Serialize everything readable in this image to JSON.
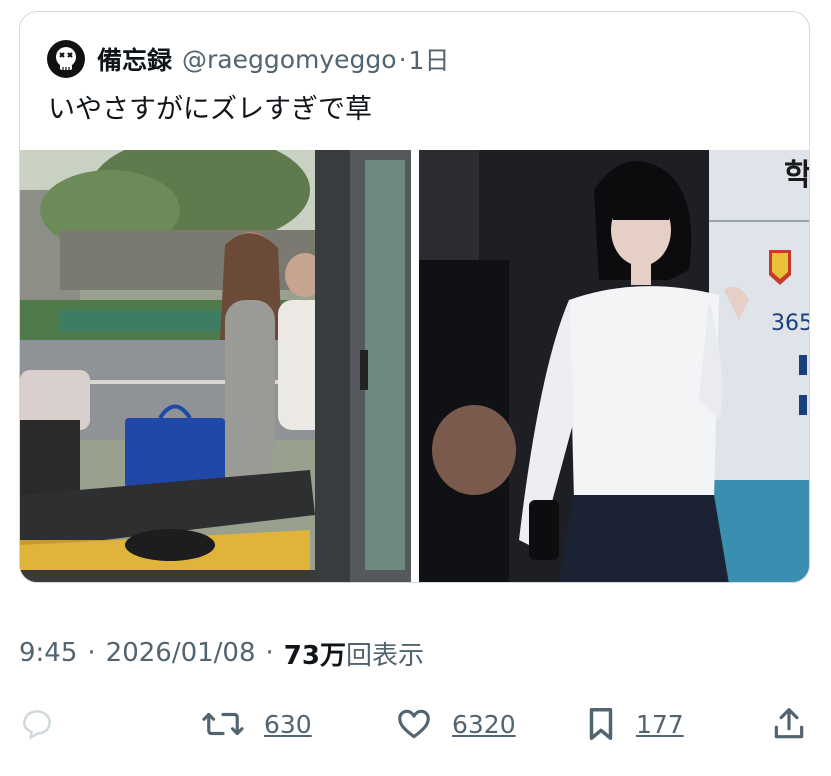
{
  "quote": {
    "display_name": "備忘録",
    "handle": "@raeggomyeggo",
    "separator": "·",
    "time": "1日",
    "text": "いやさすがにズレすぎで草"
  },
  "media": [
    {
      "label": "photo-bus-stop"
    },
    {
      "label": "photo-smiling-woman"
    }
  ],
  "meta": {
    "time": "9:45",
    "date": "2026/01/08",
    "sep": "·",
    "views_count": "73万",
    "views_label": "回表示"
  },
  "actions": {
    "reply": {
      "icon": "reply-icon"
    },
    "retweet": {
      "icon": "retweet-icon",
      "count": "630"
    },
    "like": {
      "icon": "heart-icon",
      "count": "6320"
    },
    "bookmark": {
      "icon": "bookmark-icon",
      "count": "177"
    },
    "share": {
      "icon": "share-icon"
    }
  },
  "colors": {
    "text": "#0f1419",
    "muted": "#536471",
    "border": "#cfd9de",
    "icon": "#536471"
  }
}
